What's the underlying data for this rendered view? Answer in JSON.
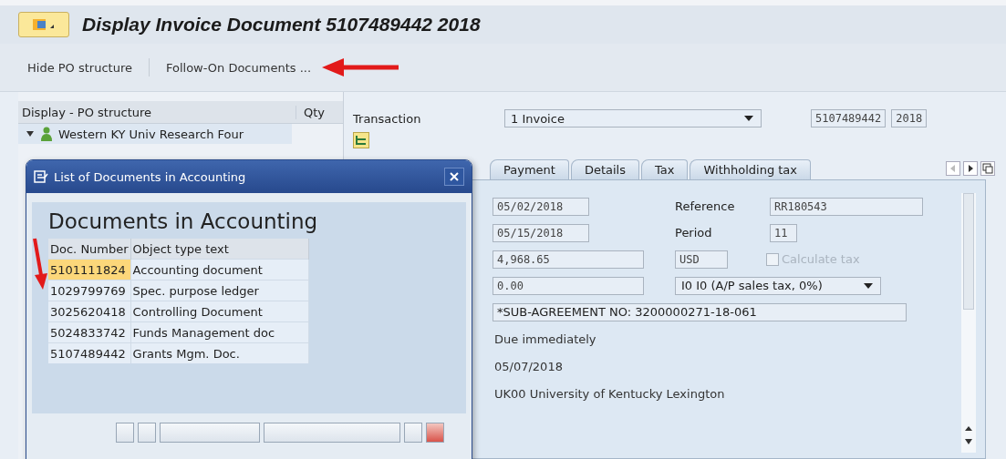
{
  "window": {
    "title": "Display Invoice Document 5107489442 2018"
  },
  "toolbar": [
    "Hide PO structure",
    "Follow-On Documents ..."
  ],
  "po_tree": {
    "columns": [
      "Display - PO structure",
      "Qty"
    ],
    "items": [
      {
        "label": "Western KY Univ Research Four",
        "expanded": true
      }
    ]
  },
  "header": {
    "label": "Transaction",
    "transaction": "1 Invoice",
    "doc_number": "5107489442",
    "year": "2018"
  },
  "tabs": [
    {
      "label": "Payment",
      "selected": false
    },
    {
      "label": "Details",
      "selected": false
    },
    {
      "label": "Tax",
      "selected": false
    },
    {
      "label": "Withholding tax",
      "selected": false
    }
  ],
  "form_rows": [
    {
      "kind": "pair",
      "value": "05/02/2018",
      "label": "Reference",
      "value2": "RR180543"
    },
    {
      "kind": "pair",
      "value": "05/15/2018",
      "label": "Period",
      "value2": "11"
    },
    {
      "kind": "amount",
      "value": "4,968.65",
      "value2": "USD",
      "checkbox": {
        "label": "Calculate tax",
        "checked": false,
        "disabled": true
      }
    },
    {
      "kind": "tax",
      "value": "0.00",
      "value2": "I0 I0 (A/P sales tax, 0%)"
    },
    {
      "kind": "wide",
      "value": "*SUB-AGREEMENT NO: 3200000271-18-061"
    },
    {
      "kind": "text",
      "value": "Due immediately"
    },
    {
      "kind": "text",
      "value": "05/07/2018"
    },
    {
      "kind": "text",
      "value": "UK00 University of Kentucky Lexington"
    }
  ],
  "dialog": {
    "title": "List of Documents in Accounting",
    "heading": "Documents in Accounting",
    "columns": [
      "Doc. Number",
      "Object type text"
    ],
    "rows": [
      {
        "number": "5101111824",
        "text": "Accounting document",
        "selected": true
      },
      {
        "number": "1029799769",
        "text": "Spec. purpose ledger",
        "selected": false
      },
      {
        "number": "3025620418",
        "text": "Controlling Document",
        "selected": false
      },
      {
        "number": "5024833742",
        "text": "Funds Management doc",
        "selected": false
      },
      {
        "number": "5107489442",
        "text": "Grants Mgm. Doc.",
        "selected": false
      }
    ]
  }
}
